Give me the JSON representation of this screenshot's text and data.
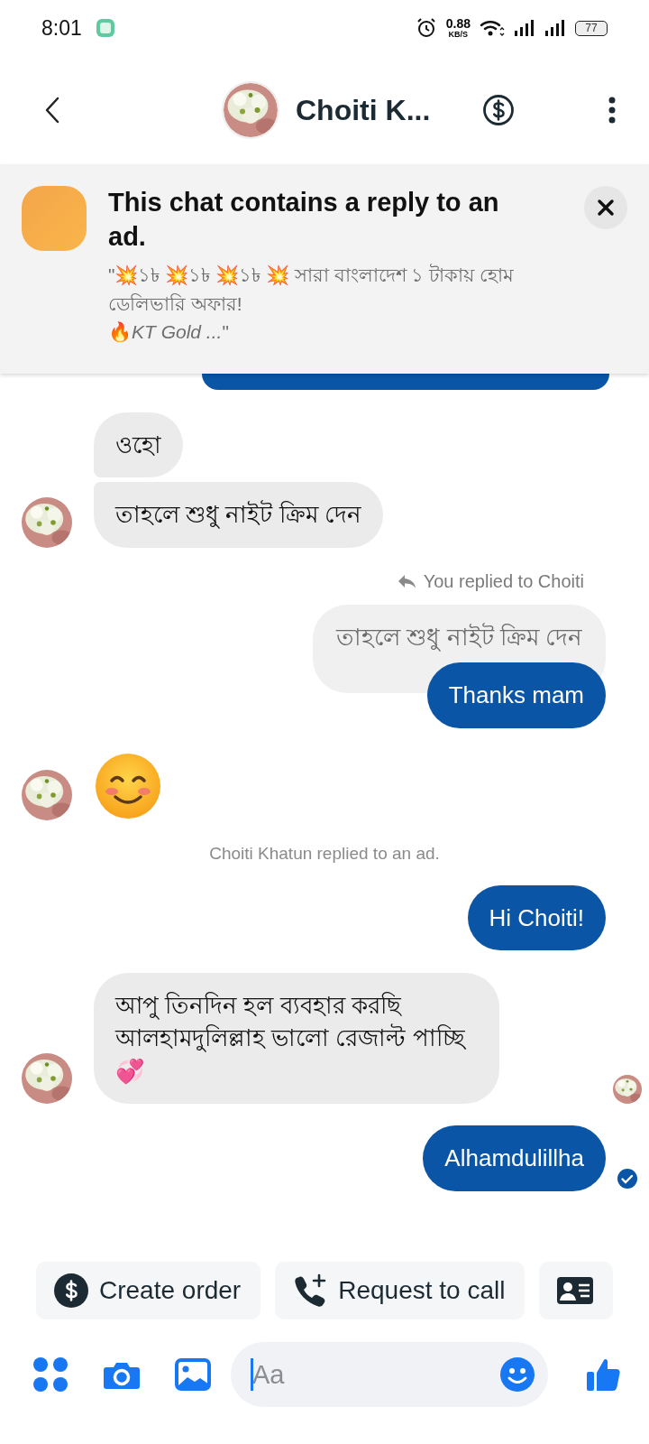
{
  "status_bar": {
    "time": "8:01",
    "network_speed": "0.88",
    "speed_unit": "KB/S",
    "battery": "77"
  },
  "header": {
    "title": "Choiti K..."
  },
  "ad_banner": {
    "title": "This chat contains a reply to an ad.",
    "quote": "\"💥১৳ 💥১৳ 💥১৳ 💥 সারা বাংলাদেশ ১ টাকায় হোম ডেলিভারি অফার!\n🔥*KT Gold ...*\""
  },
  "messages": [
    {
      "kind": "cut"
    },
    {
      "kind": "received",
      "text": "ওহো",
      "avatar": false
    },
    {
      "kind": "received",
      "text": "তাহলে শুধু নাইট ক্রিম দেন",
      "avatar": true
    },
    {
      "kind": "reply_label",
      "text": "You replied to Choiti"
    },
    {
      "kind": "quote",
      "text": "তাহলে শুধু নাইট ক্রিম দেন"
    },
    {
      "kind": "sent",
      "text": "Thanks mam"
    },
    {
      "kind": "emoji",
      "avatar": true
    },
    {
      "kind": "event",
      "text": "Choiti Khatun replied to an ad."
    },
    {
      "kind": "sent",
      "text": "Hi Choiti!"
    },
    {
      "kind": "received",
      "text": "আপু তিনদিন হল ব্যবহার করছি আলহামদুলিল্লাহ ভালো রেজাল্ট পাচ্ছি 💞",
      "avatar": true,
      "read_receipt": true
    },
    {
      "kind": "sent",
      "text": "Alhamdulillha",
      "delivered": true
    }
  ],
  "quick_replies": [
    {
      "kind": "order",
      "label": "Create order"
    },
    {
      "kind": "call",
      "label": "Request to call"
    },
    {
      "kind": "contact"
    }
  ],
  "composer": {
    "placeholder": "Aa"
  }
}
